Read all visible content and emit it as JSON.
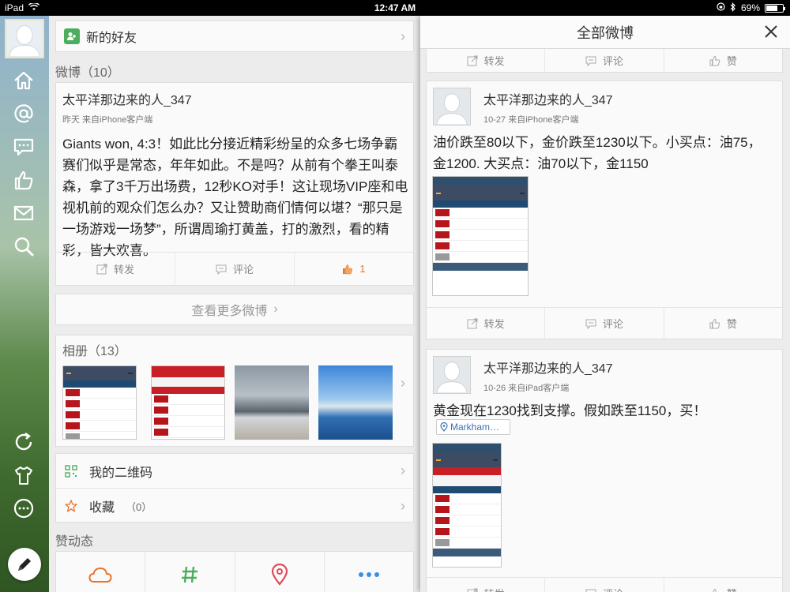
{
  "status_bar": {
    "device": "iPad",
    "time": "12:47 AM",
    "battery": "69%",
    "battery_level": 0.69
  },
  "sidebar": {
    "icons": [
      "home-icon",
      "at-icon",
      "message-icon",
      "thumbs-up-icon",
      "mail-icon",
      "search-icon",
      "refresh-icon",
      "shirt-icon",
      "more-icon",
      "compose-icon"
    ]
  },
  "left": {
    "new_friends": "新的好友",
    "weibo_section": "微博（10）",
    "post": {
      "user": "太平洋那边来的人_347",
      "meta": "昨天  来自iPhone客户端",
      "text": "Giants won, 4:3！如此比分接近精彩纷呈的众多七场争霸赛们似乎是常态，年年如此。不是吗？从前有个拳王叫泰森，拿了3千万出场费，12秒KO对手！这让现场VIP座和电视机前的观众们怎么办？又让赞助商们情何以堪？“那只是一场游戏一场梦”，所谓周瑜打黄盖，打的激烈，看的精彩，皆大欢喜。",
      "repost": "转发",
      "comment": "评论",
      "like_count": "1"
    },
    "more_posts": "查看更多微博",
    "album_title": "相册（13）",
    "qr_code": "我的二维码",
    "favorites": "收藏",
    "favorites_count": "（0）",
    "likes_title": "赞动态"
  },
  "right": {
    "header_title": "全部微博",
    "actions": {
      "repost": "转发",
      "comment": "评论",
      "like": "赞"
    },
    "posts": [
      {
        "user": "太平洋那边来的人_347",
        "meta": "10-27  来自iPhone客户端",
        "text": "油价跌至80以下，金价跌至1230以下。小买点：油75，金1200. 大买点：油70以下，金1150"
      },
      {
        "user": "太平洋那边来的人_347",
        "meta": "10-26  来自iPad客户端",
        "text": "黄金现在1230找到支撑。假如跌至1150，买！",
        "location": "Markham…"
      }
    ]
  },
  "colors": {
    "accent_green": "#4cae5c",
    "like_orange": "#e8742e",
    "link_blue": "#3a6fb6"
  }
}
